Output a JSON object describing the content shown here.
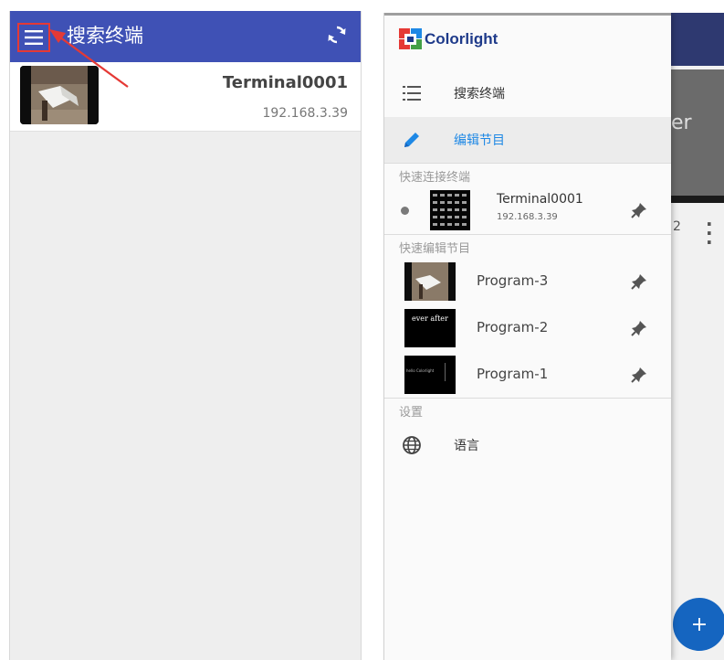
{
  "left": {
    "title": "搜索终端",
    "colors": {
      "appbar": "#3f51b5",
      "highlight": "#e53935"
    },
    "terminal": {
      "name": "Terminal0001",
      "ip": "192.168.3.39"
    }
  },
  "drawer": {
    "logo": "Colorlight",
    "nav": [
      {
        "label": "搜索终端",
        "icon": "list-icon"
      },
      {
        "label": "编辑节目",
        "icon": "pencil-icon",
        "active": true
      }
    ],
    "quick_connect": {
      "header": "快速连接终端",
      "items": [
        {
          "name": "Terminal0001",
          "ip": "192.168.3.39"
        }
      ]
    },
    "quick_edit": {
      "header": "快速编辑节目",
      "items": [
        {
          "name": "Program-3",
          "thumb_text": ""
        },
        {
          "name": "Program-2",
          "thumb_text": "ever after"
        },
        {
          "name": "Program-1",
          "thumb_text": "hello Colorlight"
        }
      ]
    },
    "settings": {
      "header": "设置",
      "items": [
        {
          "label": "语言",
          "icon": "globe-icon"
        }
      ]
    }
  },
  "background": {
    "partial_title": "er",
    "partial_count": "2",
    "fab_label": "+"
  }
}
